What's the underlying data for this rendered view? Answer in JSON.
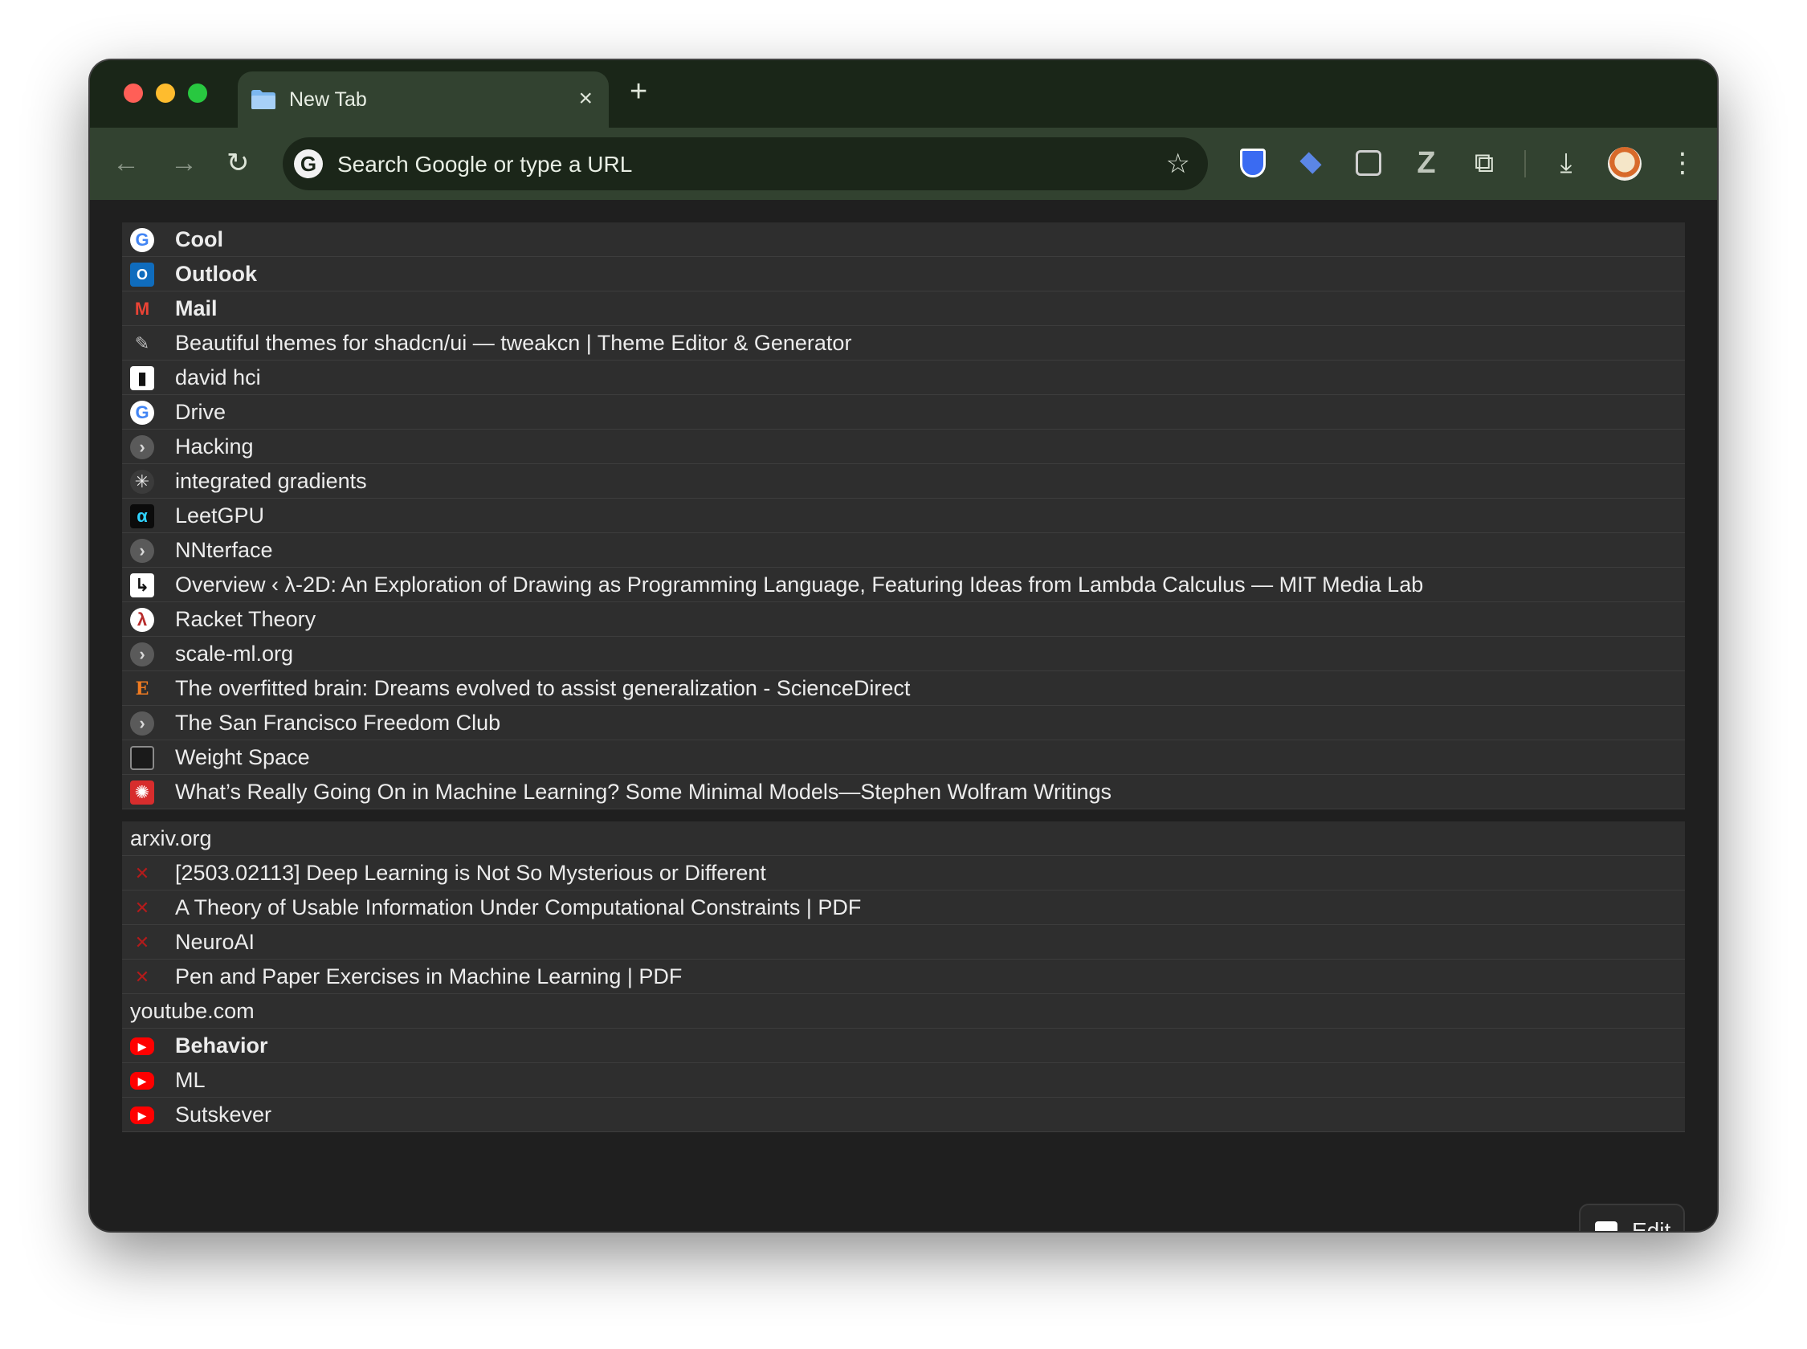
{
  "tab": {
    "title": "New Tab",
    "close": "×",
    "new_tab": "+"
  },
  "toolbar": {
    "back": "←",
    "forward": "→",
    "reload": "↻",
    "search_placeholder": "Search Google or type a URL",
    "star": "☆",
    "menu": "⋮",
    "puzzle": "⧉",
    "download": "⤓",
    "z_ext": "Z"
  },
  "bookmarks": [
    {
      "label": "Cool",
      "icon": "google-icon",
      "glyph": "G",
      "style": "google",
      "bold": true
    },
    {
      "label": "Outlook",
      "icon": "outlook-icon",
      "glyph": "O",
      "style": "outlook",
      "bold": true
    },
    {
      "label": "Mail",
      "icon": "gmail-icon",
      "glyph": "M",
      "style": "gmail",
      "bold": true
    },
    {
      "label": "Beautiful themes for shadcn/ui — tweakcn | Theme Editor & Generator",
      "icon": "tweakcn-icon",
      "glyph": "✎",
      "style": "tweak",
      "bold": false
    },
    {
      "label": "david hci",
      "icon": "linear-icon",
      "glyph": "▮",
      "style": "linear",
      "bold": false
    },
    {
      "label": "Drive",
      "icon": "google-icon",
      "glyph": "G",
      "style": "google",
      "bold": false
    },
    {
      "label": "Hacking",
      "icon": "folder-chevron-icon",
      "glyph": "›",
      "style": "grey",
      "bold": false
    },
    {
      "label": "integrated gradients",
      "icon": "sparkle-icon",
      "glyph": "✳",
      "style": "sparkle",
      "bold": false
    },
    {
      "label": "LeetGPU",
      "icon": "leetgpu-icon",
      "glyph": "α",
      "style": "leet",
      "bold": false
    },
    {
      "label": "NNterface",
      "icon": "folder-chevron-icon",
      "glyph": "›",
      "style": "grey",
      "bold": false
    },
    {
      "label": "Overview ‹ λ-2D: An Exploration of Drawing as Programming Language, Featuring Ideas from Lambda Calculus — MIT Media Lab",
      "icon": "media-lab-icon",
      "glyph": "↳",
      "style": "lambda",
      "bold": false
    },
    {
      "label": "Racket Theory",
      "icon": "racket-icon",
      "glyph": "λ",
      "style": "racket",
      "bold": false
    },
    {
      "label": "scale-ml.org",
      "icon": "folder-chevron-icon",
      "glyph": "›",
      "style": "grey",
      "bold": false
    },
    {
      "label": "The overfitted brain: Dreams evolved to assist generalization - ScienceDirect",
      "icon": "elsevier-icon",
      "glyph": "E",
      "style": "elsevier",
      "bold": false
    },
    {
      "label": "The San Francisco Freedom Club",
      "icon": "folder-chevron-icon",
      "glyph": "›",
      "style": "grey",
      "bold": false
    },
    {
      "label": "Weight Space",
      "icon": "document-icon",
      "glyph": "",
      "style": "doc",
      "bold": false
    },
    {
      "label": "What’s Really Going On in Machine Learning? Some Minimal Models—Stephen Wolfram Writings",
      "icon": "wolfram-icon",
      "glyph": "✺",
      "style": "wolfram",
      "bold": false
    }
  ],
  "groups": [
    {
      "title": "arxiv.org",
      "items": [
        {
          "label": "[2503.02113] Deep Learning is Not So Mysterious or Different",
          "icon": "arxiv-icon",
          "glyph": "✕",
          "style": "arxiv",
          "bold": false
        },
        {
          "label": "A Theory of Usable Information Under Computational Constraints | PDF",
          "icon": "arxiv-icon",
          "glyph": "✕",
          "style": "arxiv",
          "bold": false
        },
        {
          "label": "NeuroAI",
          "icon": "arxiv-icon",
          "glyph": "✕",
          "style": "arxiv",
          "bold": false
        },
        {
          "label": "Pen and Paper Exercises in Machine Learning | PDF",
          "icon": "arxiv-icon",
          "glyph": "✕",
          "style": "arxiv",
          "bold": false
        }
      ]
    },
    {
      "title": "youtube.com",
      "items": [
        {
          "label": "Behavior",
          "icon": "youtube-icon",
          "glyph": "▶",
          "style": "youtube",
          "bold": true
        },
        {
          "label": "ML",
          "icon": "youtube-icon",
          "glyph": "▶",
          "style": "youtube",
          "bold": false
        },
        {
          "label": "Sutskever",
          "icon": "youtube-icon",
          "glyph": "▶",
          "style": "youtube",
          "bold": false
        }
      ]
    }
  ],
  "edit": {
    "label": "Edit"
  }
}
